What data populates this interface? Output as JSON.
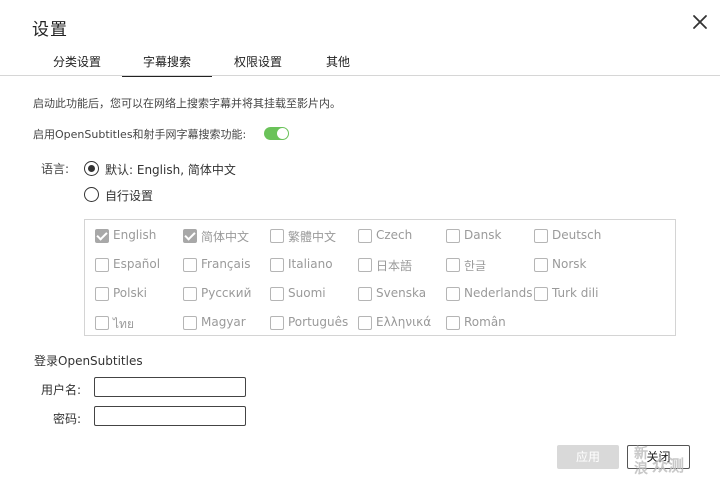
{
  "dialog": {
    "title": "设置",
    "close_icon": "close-icon"
  },
  "tabs": [
    {
      "label": "分类设置",
      "active": false
    },
    {
      "label": "字幕搜索",
      "active": true
    },
    {
      "label": "权限设置",
      "active": false
    },
    {
      "label": "其他",
      "active": false
    }
  ],
  "description": "启动此功能后，您可以在网络上搜索字幕并将其挂载至影片内。",
  "enable": {
    "label": "启用OpenSubtitles和射手网字幕搜索功能:",
    "on": true,
    "toggle_color": "#6ac259"
  },
  "language": {
    "label": "语言:",
    "options": [
      {
        "label": "默认: English, 简体中文",
        "selected": true
      },
      {
        "label": "自行设置",
        "selected": false
      }
    ],
    "list": [
      {
        "label": "English",
        "checked": true
      },
      {
        "label": "简体中文",
        "checked": true
      },
      {
        "label": "繁體中文",
        "checked": false
      },
      {
        "label": "Czech",
        "checked": false
      },
      {
        "label": "Dansk",
        "checked": false
      },
      {
        "label": "Deutsch",
        "checked": false
      },
      {
        "label": "Español",
        "checked": false
      },
      {
        "label": "Français",
        "checked": false
      },
      {
        "label": "Italiano",
        "checked": false
      },
      {
        "label": "日本語",
        "checked": false
      },
      {
        "label": "한글",
        "checked": false
      },
      {
        "label": "Norsk",
        "checked": false
      },
      {
        "label": "Polski",
        "checked": false
      },
      {
        "label": "Русский",
        "checked": false
      },
      {
        "label": "Suomi",
        "checked": false
      },
      {
        "label": "Svenska",
        "checked": false
      },
      {
        "label": "Nederlands",
        "checked": false
      },
      {
        "label": "Turk dili",
        "checked": false
      },
      {
        "label": "ไทย",
        "checked": false
      },
      {
        "label": "Magyar",
        "checked": false
      },
      {
        "label": "Português",
        "checked": false
      },
      {
        "label": "Ελληνικά",
        "checked": false
      },
      {
        "label": "Român",
        "checked": false
      }
    ]
  },
  "login": {
    "title": "登录OpenSubtitles",
    "username_label": "用户名:",
    "username_value": "",
    "password_label": "密码:",
    "password_value": ""
  },
  "buttons": {
    "apply": "应用",
    "close": "关闭"
  },
  "watermark": {
    "logo_text": "新 浪",
    "text": "众测"
  }
}
